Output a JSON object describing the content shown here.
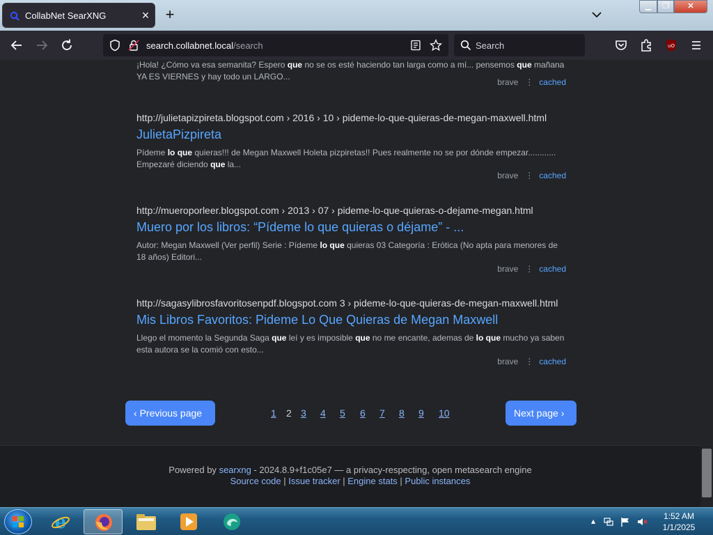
{
  "browser": {
    "tab_title": "CollabNet SearXNG",
    "url_host": "search.collabnet.local",
    "url_path": "/search",
    "search_placeholder": "Search"
  },
  "results": [
    {
      "snippet_html": "¡Hola! ¿Cómo va esa semanita? Espero <b>que</b> no se os esté haciendo tan larga como a mí... pensemos <b>que</b> mañana YA ES VIERNES y hay todo un LARGO...",
      "engine": "brave",
      "cached": "cached"
    },
    {
      "url": "http://julietapizpireta.blogspot.com",
      "path": " › 2016 › 10 › pideme-lo-que-quieras-de-megan-maxwell.html",
      "title": "JulietaPizpireta",
      "snippet_html": "Pídeme <b>lo que</b> quieras!!! de Megan Maxwell Holeta pizpiretas!! Pues realmente no se por dónde empezar............ Empezaré diciendo <b>que</b> la...",
      "engine": "brave",
      "cached": "cached"
    },
    {
      "url": "http://mueroporleer.blogspot.com",
      "path": " › 2013 › 07 › pideme-lo-que-quieras-o-dejame-megan.html",
      "title": "Muero por los libros: “Pídeme lo que quieras o déjame” - ...",
      "snippet_html": "Autor: Megan Maxwell (Ver perfil) Serie : Pídeme <b>lo que</b> quieras 03 Categoría : Erótica (No apta para menores de 18 años) Editori...",
      "engine": "brave",
      "cached": "cached"
    },
    {
      "url": "http://sagasylibrosfavoritosenpdf.blogspot.com",
      "path": " 3 › pideme-lo-que-quieras-de-megan-maxwell.html",
      "title": "Mis Libros Favoritos: Pideme Lo Que Quieras de Megan Maxwell",
      "snippet_html": "Llego el momento la Segunda Saga <b>que</b> leí y es imposible <b>que</b> no me encante, ademas de <b>lo que</b> mucho ya saben esta autora se la comió con esto...",
      "engine": "brave",
      "cached": "cached"
    }
  ],
  "pagination": {
    "prev_label": "Previous page",
    "next_label": "Next page",
    "pages": [
      "1",
      "2",
      "3",
      "4",
      "5",
      "6",
      "7",
      "8",
      "9",
      "10"
    ],
    "current": "2"
  },
  "footer": {
    "powered_by": "Powered by",
    "searxng": "searxng",
    "version_text": " - 2024.8.9+f1c05e7 — a privacy-respecting, open metasearch engine",
    "source_code": "Source code",
    "issue_tracker": "Issue tracker",
    "engine_stats": "Engine stats",
    "public_instances": "Public instances",
    "sep": " | "
  },
  "taskbar": {
    "time": "1:52 AM",
    "date": "1/1/2025"
  },
  "colors": {
    "page_bg": "#222428",
    "link": "#58a6ff",
    "button": "#4a86f7"
  }
}
